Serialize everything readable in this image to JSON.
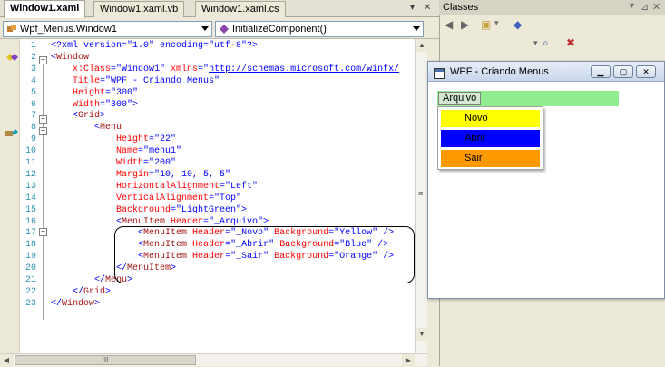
{
  "tabs": [
    "Window1.xaml",
    "Window1.xaml.vb",
    "Window1.xaml.cs"
  ],
  "combos": {
    "left": "Wpf_Menus.Window1",
    "right": "InitializeComponent()"
  },
  "code": [
    {
      "n": "1",
      "segs": [
        [
          "b",
          "<?xml version=\"1.0\" encoding=\"utf-8\"?>"
        ]
      ]
    },
    {
      "n": "2",
      "segs": [
        [
          "b",
          "<"
        ],
        [
          "m",
          "Window"
        ]
      ]
    },
    {
      "n": "3",
      "segs": [
        [
          "r",
          "    x:Class"
        ],
        [
          "b",
          "=\"Window1\" "
        ],
        [
          "r",
          "xmlns"
        ],
        [
          "b",
          "=\""
        ],
        [
          "u",
          "http://schemas.microsoft.com/winfx/"
        ]
      ]
    },
    {
      "n": "4",
      "segs": [
        [
          "r",
          "    Title"
        ],
        [
          "b",
          "=\"WPF - Criando Menus\""
        ]
      ]
    },
    {
      "n": "5",
      "segs": [
        [
          "r",
          "    Height"
        ],
        [
          "b",
          "=\"300\""
        ]
      ]
    },
    {
      "n": "6",
      "segs": [
        [
          "r",
          "    Width"
        ],
        [
          "b",
          "=\"300\">"
        ]
      ]
    },
    {
      "n": "7",
      "segs": [
        [
          "b",
          "    <"
        ],
        [
          "m",
          "Grid"
        ],
        [
          "b",
          ">"
        ]
      ]
    },
    {
      "n": "8",
      "segs": [
        [
          "b",
          "        <"
        ],
        [
          "m",
          "Menu"
        ]
      ]
    },
    {
      "n": "9",
      "segs": [
        [
          "r",
          "            Height"
        ],
        [
          "b",
          "=\"22\""
        ]
      ]
    },
    {
      "n": "10",
      "segs": [
        [
          "r",
          "            Name"
        ],
        [
          "b",
          "=\"menu1\""
        ]
      ]
    },
    {
      "n": "11",
      "segs": [
        [
          "r",
          "            Width"
        ],
        [
          "b",
          "=\"200\""
        ]
      ]
    },
    {
      "n": "12",
      "segs": [
        [
          "r",
          "            Margin"
        ],
        [
          "b",
          "=\"10, 10, 5, 5\""
        ]
      ]
    },
    {
      "n": "13",
      "segs": [
        [
          "r",
          "            HorizontalAlignment"
        ],
        [
          "b",
          "=\"Left\""
        ]
      ]
    },
    {
      "n": "14",
      "segs": [
        [
          "r",
          "            VerticalAlignment"
        ],
        [
          "b",
          "=\"Top\""
        ]
      ]
    },
    {
      "n": "15",
      "segs": [
        [
          "r",
          "            Background"
        ],
        [
          "b",
          "=\"LightGreen\">"
        ]
      ]
    },
    {
      "n": "16",
      "segs": [
        [
          "b",
          "            <"
        ],
        [
          "m",
          "MenuItem "
        ],
        [
          "r",
          "Header"
        ],
        [
          "b",
          "=\"_Arquivo\">"
        ]
      ]
    },
    {
      "n": "17",
      "segs": [
        [
          "b",
          "                <"
        ],
        [
          "m",
          "MenuItem "
        ],
        [
          "r",
          "Header"
        ],
        [
          "b",
          "=\"_Novo\" "
        ],
        [
          "r",
          "Background"
        ],
        [
          "b",
          "=\"Yellow\" />"
        ]
      ]
    },
    {
      "n": "18",
      "segs": [
        [
          "b",
          "                <"
        ],
        [
          "m",
          "MenuItem "
        ],
        [
          "r",
          "Header"
        ],
        [
          "b",
          "=\"_Abrir\" "
        ],
        [
          "r",
          "Background"
        ],
        [
          "b",
          "=\"Blue\" />"
        ]
      ]
    },
    {
      "n": "19",
      "segs": [
        [
          "b",
          "                <"
        ],
        [
          "m",
          "MenuItem "
        ],
        [
          "r",
          "Header"
        ],
        [
          "b",
          "=\"_Sair\" "
        ],
        [
          "r",
          "Background"
        ],
        [
          "b",
          "=\"Orange\" />"
        ]
      ]
    },
    {
      "n": "20",
      "segs": [
        [
          "b",
          "            </"
        ],
        [
          "m",
          "MenuItem"
        ],
        [
          "b",
          ">"
        ]
      ]
    },
    {
      "n": "21",
      "segs": [
        [
          "b",
          "        </"
        ],
        [
          "m",
          "Menu"
        ],
        [
          "b",
          ">"
        ]
      ]
    },
    {
      "n": "22",
      "segs": [
        [
          "b",
          "    </"
        ],
        [
          "m",
          "Grid"
        ],
        [
          "b",
          ">"
        ]
      ]
    },
    {
      "n": "23",
      "segs": [
        [
          "b",
          "</"
        ],
        [
          "m",
          "Window"
        ],
        [
          "b",
          ">"
        ]
      ]
    }
  ],
  "classes_panel": {
    "title": "Classes"
  },
  "preview_window": {
    "title": "WPF - Criando Menus",
    "menu_header": "Arquivo",
    "items": [
      {
        "label": "Novo",
        "color": "#ffff00"
      },
      {
        "label": "Abrir",
        "color": "#0000ff"
      },
      {
        "label": "Sair",
        "color": "#ff9900"
      }
    ],
    "menu_background": "#90ee90"
  },
  "scroll_thumb_label": "III"
}
